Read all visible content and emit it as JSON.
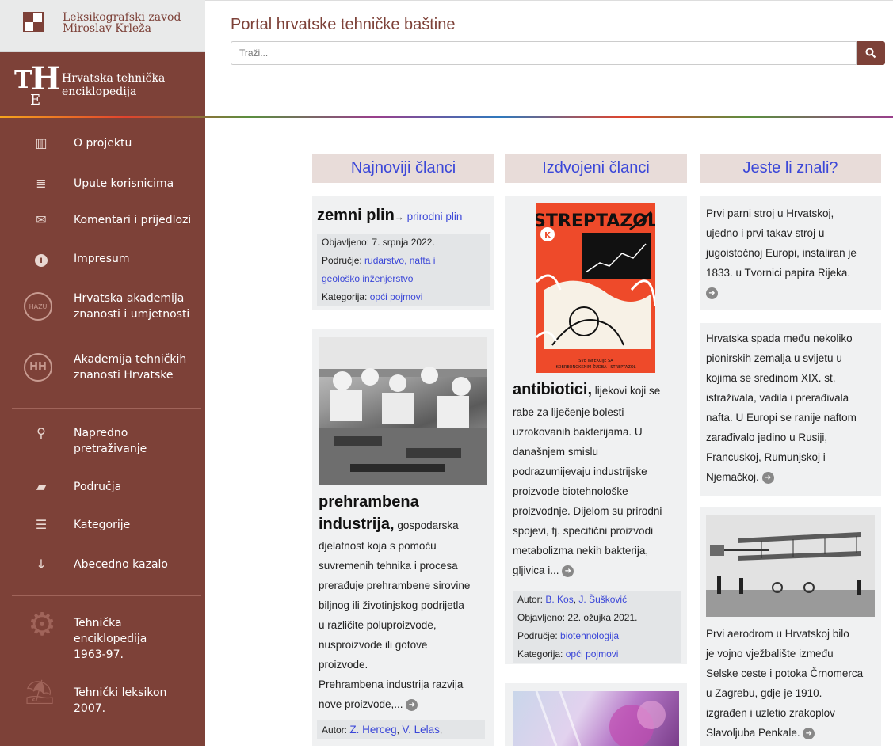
{
  "sidebar": {
    "lzmk_line1": "Leksikografski zavod",
    "lzmk_line2": "Miroslav Krleža",
    "the_t": "T",
    "the_h": "H",
    "the_e": "E",
    "the_line1": "Hrvatska tehnička",
    "the_line2": "enciklopedija",
    "items": [
      {
        "label": "O projektu",
        "icon": "book-icon"
      },
      {
        "label": "Upute korisnicima",
        "icon": "document-icon"
      },
      {
        "label": "Komentari i prijedlozi",
        "icon": "envelope-icon"
      },
      {
        "label": "Impresum",
        "icon": "info-icon"
      },
      {
        "label": "Hrvatska akademija znanosti i umjetnosti",
        "icon": "hazu-seal-icon"
      },
      {
        "label": "Akademija tehničkih znanosti Hrvatske",
        "icon": "hatz-seal-icon"
      },
      {
        "label": "Napredno pretraživanje",
        "icon": "search-icon"
      },
      {
        "label": "Područja",
        "icon": "folder-icon"
      },
      {
        "label": "Kategorije",
        "icon": "list-icon"
      },
      {
        "label": "Abecedno kazalo",
        "icon": "sort-alpha-icon"
      },
      {
        "label": "Tehnička enciklopedija 1963-97.",
        "icon": "gear-icon"
      },
      {
        "label": "Tehnički leksikon 2007.",
        "icon": "parachute-icon"
      }
    ],
    "glyphs": {
      "book": "▥",
      "doc": "≣",
      "env": "✉",
      "info": "i",
      "search": "⚲",
      "folder": "▰",
      "list": "☰",
      "sort": "↓",
      "gear": "⚙",
      "parachute": "⛱",
      "seal1": "HAZU",
      "seal2": "HH"
    }
  },
  "header": {
    "title": "Portal hrvatske tehničke baštine",
    "search_placeholder": "Traži..."
  },
  "columns": {
    "newest": {
      "title": "Najnoviji članci",
      "card1": {
        "title": "zemni plin",
        "arrow": "→",
        "link": "prirodni plin",
        "published_label": "Objavljeno:",
        "published": "7. srpnja 2022.",
        "area_label": "Područje:",
        "area_1": "rudarstvo, nafta i",
        "area_2": "geološko inženjerstvo",
        "category_label": "Kategorija:",
        "category": "opći pojmovi"
      },
      "card2": {
        "title_1": "prehrambena",
        "title_2": "industrija,",
        "text_0": "gospodarska",
        "text_1": "djelatnost koja s pomoću",
        "text_2": "suvremenih tehnika i procesa",
        "text_3": "prerađuje prehrambene sirovine",
        "text_4": "biljnog ili životinjskog podrijetla",
        "text_5": "u različite poluproizvode,",
        "text_6": "nusproizvode ili gotove",
        "text_7": "proizvode.",
        "text_8": "Prehrambena industrija razvija",
        "text_9": "nove proizvode,...",
        "author_label": "Autor:",
        "author_1": "Z. Herceg",
        "author_2": "V. Lelas",
        "sep": ","
      }
    },
    "featured": {
      "title": "Izdvojeni članci",
      "card1": {
        "poster_title": "STREPTAZOL",
        "poster_k": "K",
        "poster_caption_1": "SVE INFEKCIJE SA",
        "poster_caption_2": "KOBREONOKKNIM ŽUDBA · STREPTAZOL",
        "title": "antibiotici,",
        "text_0": "lijekovi koji se",
        "text_1": "rabe za liječenje bolesti",
        "text_2": "uzrokovanih bakterijama. U",
        "text_3": "današnjem smislu",
        "text_4": "podrazumijevaju industrijske",
        "text_5": "proizvode biotehnološke",
        "text_6": "proizvodnje. Dijelom su prirodni",
        "text_7": "spojevi, tj. specifični proizvodi",
        "text_8": "metabolizma nekih bakterija,",
        "text_9": "gljivica i...",
        "author_label": "Autor:",
        "author_1": "B. Kos",
        "author_2": "J. Šušković",
        "sep": ",",
        "published_label": "Objavljeno:",
        "published": "22. ožujka 2021.",
        "area_label": "Područje:",
        "area": "biotehnologija",
        "category_label": "Kategorija:",
        "category": "opći pojmovi"
      }
    },
    "didyouknow": {
      "title": "Jeste li znali?",
      "card1": [
        "Prvi parni stroj u Hrvatskoj,",
        "ujedno i prvi takav stroj u",
        "jugoistočnoj Europi, instaliran je",
        "1833. u Tvornici papira Rijeka."
      ],
      "card2": [
        "Hrvatska spada među nekoliko",
        "pionirskih zemalja u svijetu u",
        "kojima se sredinom XIX. st.",
        "istraživala, vadila i prerađivala",
        "nafta. U Europi se ranije naftom",
        "zarađivalo jedino u Rusiji,",
        "Francuskoj, Rumunjskoj i",
        "Njemačkoj."
      ],
      "card3": [
        "Prvi aerodrom u Hrvatskoj bilo",
        "je vojno vježbalište između",
        "Selske ceste i potoka Črnomerca",
        "u Zagrebu, gdje je 1910.",
        "izgrađen i uzletio zrakoplov",
        "Slavoljuba Penkale."
      ]
    },
    "more_glyph": "➜"
  }
}
